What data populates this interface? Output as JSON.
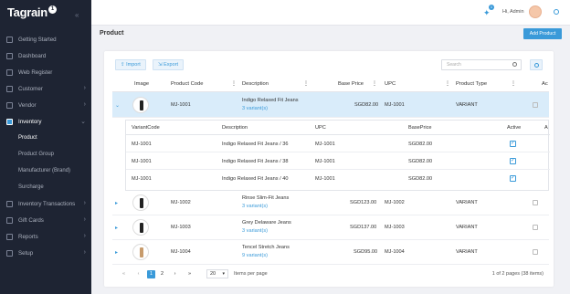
{
  "app": {
    "logo": "Tagrain",
    "logo_mark": "1"
  },
  "sidebar": {
    "items": [
      {
        "label": "Getting Started",
        "chev": ""
      },
      {
        "label": "Dashboard",
        "chev": ""
      },
      {
        "label": "Web Register",
        "chev": ""
      },
      {
        "label": "Customer",
        "chev": "›"
      },
      {
        "label": "Vendor",
        "chev": "›"
      },
      {
        "label": "Inventory",
        "chev": "⌄"
      }
    ],
    "sub_items": [
      "Product",
      "Product Group",
      "Manufacturer (Brand)",
      "Surcharge"
    ],
    "items_after": [
      {
        "label": "Inventory Transactions",
        "chev": "›"
      },
      {
        "label": "Gift Cards",
        "chev": "›"
      },
      {
        "label": "Reports",
        "chev": "›"
      },
      {
        "label": "Setup",
        "chev": "›"
      }
    ]
  },
  "header": {
    "greeting": "Hi, Admin",
    "notif_count": "1"
  },
  "page": {
    "title": "Product",
    "add_label": "Add Product"
  },
  "toolbar": {
    "import_label": "Import",
    "export_label": "Export",
    "search_placeholder": "Search"
  },
  "table": {
    "columns": [
      "Image",
      "Product Code",
      "Description",
      "Base Price",
      "UPC",
      "Product Type",
      "Ac"
    ],
    "rows": [
      {
        "code": "MJ-1001",
        "desc": "Indigo Relaxed Fit Jeans",
        "variants": "3 variant(s)",
        "price": "SGD82.00",
        "upc": "MJ-1001",
        "type": "VARIANT"
      },
      {
        "code": "MJ-1002",
        "desc": "Rinse Slim-Fit Jeans",
        "variants": "3 variant(s)",
        "price": "SGD123.00",
        "upc": "MJ-1002",
        "type": "VARIANT"
      },
      {
        "code": "MJ-1003",
        "desc": "Grey Delaware Jeans",
        "variants": "3 variant(s)",
        "price": "SGD137.00",
        "upc": "MJ-1003",
        "type": "VARIANT"
      },
      {
        "code": "MJ-1004",
        "desc": "Tencel Stretch Jeans",
        "variants": "9 variant(s)",
        "price": "SGD95.00",
        "upc": "MJ-1004",
        "type": "VARIANT"
      }
    ]
  },
  "variants": {
    "columns": [
      "VariantCode",
      "Description",
      "UPC",
      "BasePrice",
      "Active",
      "A"
    ],
    "rows": [
      {
        "code": "MJ-1001",
        "desc": "Indigo Relaxed Fit Jeans / 36",
        "upc": "MJ-1001",
        "price": "SGD82.00"
      },
      {
        "code": "MJ-1001",
        "desc": "Indigo Relaxed Fit Jeans / 38",
        "upc": "MJ-1001",
        "price": "SGD82.00"
      },
      {
        "code": "MJ-1001",
        "desc": "Indigo Relaxed Fit Jeans / 40",
        "upc": "MJ-1001",
        "price": "SGD82.00"
      }
    ]
  },
  "pager": {
    "first": "«",
    "prev": "‹",
    "page1": "1",
    "page2": "2",
    "next": "›",
    "last": "»",
    "size": "20",
    "per_page_label": "Items per page",
    "info": "1 of 2 pages (38 items)"
  }
}
